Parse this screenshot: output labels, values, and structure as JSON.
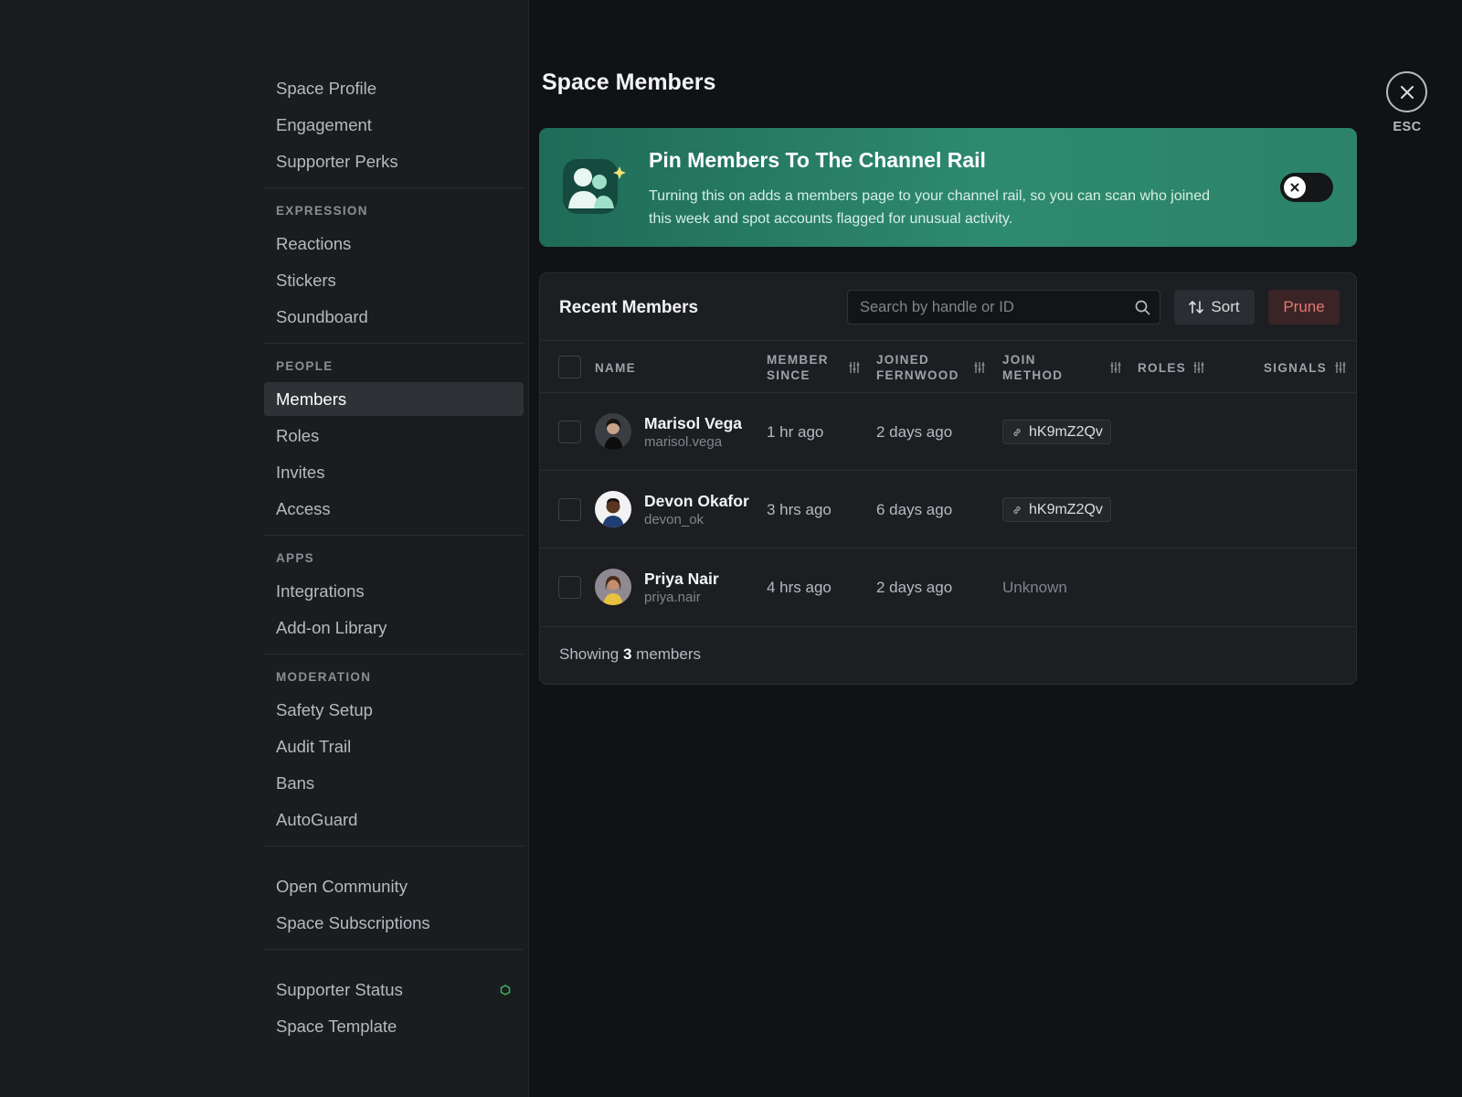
{
  "sidebar": {
    "groups": [
      {
        "header": "",
        "items": [
          "Space Profile",
          "Engagement",
          "Supporter Perks"
        ]
      },
      {
        "header": "EXPRESSION",
        "items": [
          "Reactions",
          "Stickers",
          "Soundboard"
        ]
      },
      {
        "header": "PEOPLE",
        "items": [
          "Members",
          "Roles",
          "Invites",
          "Access"
        ]
      },
      {
        "header": "APPS",
        "items": [
          "Integrations",
          "Add-on Library"
        ]
      },
      {
        "header": "MODERATION",
        "items": [
          "Safety Setup",
          "Audit Trail",
          "Bans",
          "AutoGuard"
        ]
      },
      {
        "header": "",
        "items": [
          "Open Community",
          "Space Subscriptions"
        ]
      },
      {
        "header": "",
        "items": [
          "Supporter Status",
          "Space Template"
        ]
      }
    ],
    "active_item": "Members",
    "status_item": "Supporter Status",
    "status_color": "#3ba55c"
  },
  "page": {
    "title": "Space Members"
  },
  "close": {
    "label": "ESC",
    "icon": "close-icon"
  },
  "banner": {
    "title": "Pin Members To The Channel Rail",
    "description": "Turning this on adds a members page to your channel rail, so you can scan who joined this week and spot accounts flagged for unusual activity.",
    "toggle_on": false,
    "accent": "#2e8a6e"
  },
  "members_card": {
    "title": "Recent Members",
    "search_placeholder": "Search by handle or ID",
    "sort_label": "Sort",
    "prune_label": "Prune",
    "columns": {
      "name": "NAME",
      "member_since_1": "MEMBER",
      "member_since_2": "SINCE",
      "joined_1": "JOINED",
      "joined_2": "FERNWOOD",
      "join_method_1": "JOIN",
      "join_method_2": "METHOD",
      "roles": "ROLES",
      "signals": "SIGNALS"
    },
    "rows": [
      {
        "name": "Marisol Vega",
        "handle": "marisol.vega",
        "member_since": "1 hr ago",
        "joined": "2 days ago",
        "join_method": "hK9mZ2Qv",
        "method_type": "invite"
      },
      {
        "name": "Devon Okafor",
        "handle": "devon_ok",
        "member_since": "3 hrs ago",
        "joined": "6 days ago",
        "join_method": "hK9mZ2Qv",
        "method_type": "invite"
      },
      {
        "name": "Priya Nair",
        "handle": "priya.nair",
        "member_since": "4 hrs ago",
        "joined": "2 days ago",
        "join_method": "Unknown",
        "method_type": "unknown"
      }
    ],
    "footer": {
      "prefix": "Showing",
      "count": "3",
      "suffix": "members"
    }
  }
}
